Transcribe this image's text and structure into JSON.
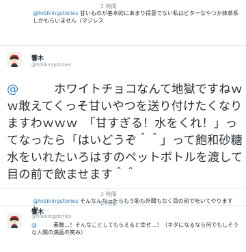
{
  "tweets": [
    {
      "time": "2 時間",
      "mention": "@hibikingstories",
      "text": " 甘いものが基本的にあまり得意でない私はビターなやつか抹茶系しかもらいません（マジレス"
    },
    {
      "name": "響木",
      "handle": "@hibikingstories",
      "time": "2 時間",
      "mention": "@",
      "text": "　　　ホワイトチョコなんて地獄ですねｗｗ敢えてくっそ甘いやつを送り付けたくなりますわｗｗｗ　「甘すぎる！水をくれ！」ってなったら「はいどうぞ＾＾」って飽和砂糖水をいれたいろはすのペットボトルを渡して目の前で飲ませます＾＾"
    },
    {
      "time": "2 時間",
      "mention": "@hibikingstories",
      "text": " そんなんなったらもう恥も外聞もなく目の前で吐いてやりますわ……"
    },
    {
      "name": "響木",
      "handle": "@hibikingstories",
      "time": "2 時間",
      "mention": "@",
      "text": "　　　素敵…！そんなことしてもらえると幸せ…！（ネタになるなら何でもしそうな人間の満面の笑み）"
    }
  ],
  "icons": {
    "avatar": "avatar-image-icon"
  },
  "colors": {
    "mention": "#2b7bb9",
    "meta": "#8899a6",
    "divider": "#e1e8ed"
  }
}
